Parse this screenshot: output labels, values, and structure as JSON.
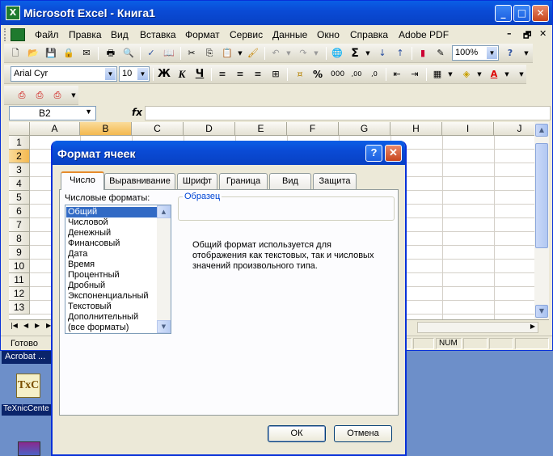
{
  "excel": {
    "title": "Microsoft Excel - Книга1",
    "app_icon": "excel-icon",
    "menu": [
      "Файл",
      "Правка",
      "Вид",
      "Вставка",
      "Формат",
      "Сервис",
      "Данные",
      "Окно",
      "Справка",
      "Adobe PDF"
    ],
    "font_name": "Arial Cyr",
    "font_size": "10",
    "zoom": "100%",
    "bold": "Ж",
    "italic": "К",
    "underline": "Ч",
    "percent": "%",
    "thousands": "000",
    "sigma": "Σ",
    "fx": "fx",
    "name_box": "B2",
    "columns": [
      "A",
      "B",
      "C",
      "D",
      "E",
      "F",
      "G",
      "H",
      "I",
      "J"
    ],
    "selected_column": "B",
    "rows": [
      "1",
      "2",
      "3",
      "4",
      "5",
      "6",
      "7",
      "8",
      "9",
      "10",
      "11",
      "12",
      "13"
    ],
    "selected_row": "2",
    "status_ready": "Готово",
    "status_num": "NUM"
  },
  "desktop": {
    "acrobat_label": "Acrobat ...",
    "texnic_label": "TeXnicCente",
    "texnic_icon_text": "TxC"
  },
  "dialog": {
    "title": "Формат ячеек",
    "help": "?",
    "tabs": [
      "Число",
      "Выравнивание",
      "Шрифт",
      "Граница",
      "Вид",
      "Защита"
    ],
    "active_tab": "Число",
    "formats_label": "Числовые форматы:",
    "formats": [
      "Общий",
      "Числовой",
      "Денежный",
      "Финансовый",
      "Дата",
      "Время",
      "Процентный",
      "Дробный",
      "Экспоненциальный",
      "Текстовый",
      "Дополнительный",
      "(все форматы)"
    ],
    "selected_format": "Общий",
    "sample_legend": "Образец",
    "description": "Общий формат используется для отображения как текстовых, так и числовых значений произвольного типа.",
    "ok": "ОК",
    "cancel": "Отмена"
  }
}
